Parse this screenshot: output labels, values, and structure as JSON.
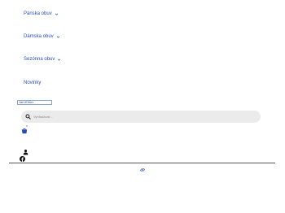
{
  "nav": {
    "items": [
      {
        "label": "Pánska obuv",
        "icon": "chevron-down-icon"
      },
      {
        "label": "Dámska obuv",
        "icon": "chevron-down-icon"
      },
      {
        "label": "Sezónna obuv",
        "icon": "chevron-down-icon"
      },
      {
        "label": "Novinky"
      }
    ]
  },
  "logo": {
    "alt_text": "JarniObuv"
  },
  "search": {
    "placeholder": "Vyhľadávať...",
    "value": ""
  },
  "cart": {
    "count": "0",
    "icon": "cart-icon"
  },
  "icons": {
    "user": "user-icon",
    "facebook": "facebook-icon",
    "link": "link-icon"
  },
  "colors": {
    "accent": "#2a4fb3",
    "search_bg": "#ebebeb",
    "divider": "#555555"
  }
}
